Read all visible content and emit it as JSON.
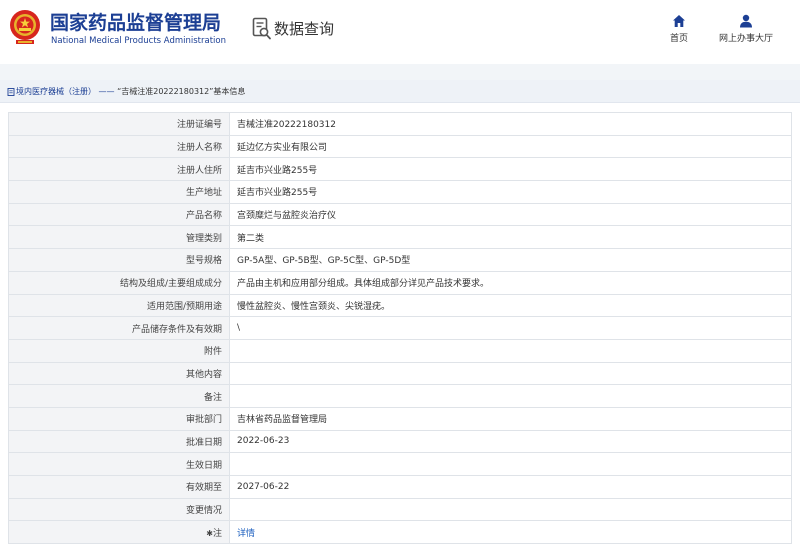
{
  "header": {
    "brand_cn": "国家药品监督管理局",
    "brand_en": "National Medical Products Administration",
    "section_title": "数据查询",
    "nav": [
      {
        "label": "首页",
        "icon": "home-icon"
      },
      {
        "label": "网上办事大厅",
        "icon": "user-icon"
      }
    ]
  },
  "breadcrumb": {
    "category": "境内医疗器械（注册）",
    "separator": " —— ",
    "current": "“吉械注准20222180312”基本信息"
  },
  "colors": {
    "brand_blue": "#1c3f94",
    "label_bg": "#f3f4f6",
    "border": "#dfe3e8",
    "link": "#1c5fbf"
  },
  "rows": [
    {
      "label": "注册证编号",
      "value": "吉械注准20222180312"
    },
    {
      "label": "注册人名称",
      "value": "延边亿方实业有限公司"
    },
    {
      "label": "注册人住所",
      "value": "延吉市兴业路255号"
    },
    {
      "label": "生产地址",
      "value": "延吉市兴业路255号"
    },
    {
      "label": "产品名称",
      "value": "宫颈糜烂与盆腔炎治疗仪"
    },
    {
      "label": "管理类别",
      "value": "第二类"
    },
    {
      "label": "型号规格",
      "value": "GP-5A型、GP-5B型、GP-5C型、GP-5D型"
    },
    {
      "label": "结构及组成/主要组成成分",
      "value": "产品由主机和应用部分组成。具体组成部分详见产品技术要求。"
    },
    {
      "label": "适用范围/预期用途",
      "value": "慢性盆腔炎、慢性宫颈炎、尖锐湿疣。"
    },
    {
      "label": "产品储存条件及有效期",
      "value": "\\"
    },
    {
      "label": "附件",
      "value": ""
    },
    {
      "label": "其他内容",
      "value": ""
    },
    {
      "label": "备注",
      "value": ""
    },
    {
      "label": "审批部门",
      "value": "吉林省药品监督管理局"
    },
    {
      "label": "批准日期",
      "value": "2022-06-23"
    },
    {
      "label": "生效日期",
      "value": ""
    },
    {
      "label": "有效期至",
      "value": "2027-06-22"
    },
    {
      "label": "变更情况",
      "value": ""
    },
    {
      "label": "注",
      "value": "详情",
      "label_icon": "star-icon",
      "link": true
    }
  ]
}
